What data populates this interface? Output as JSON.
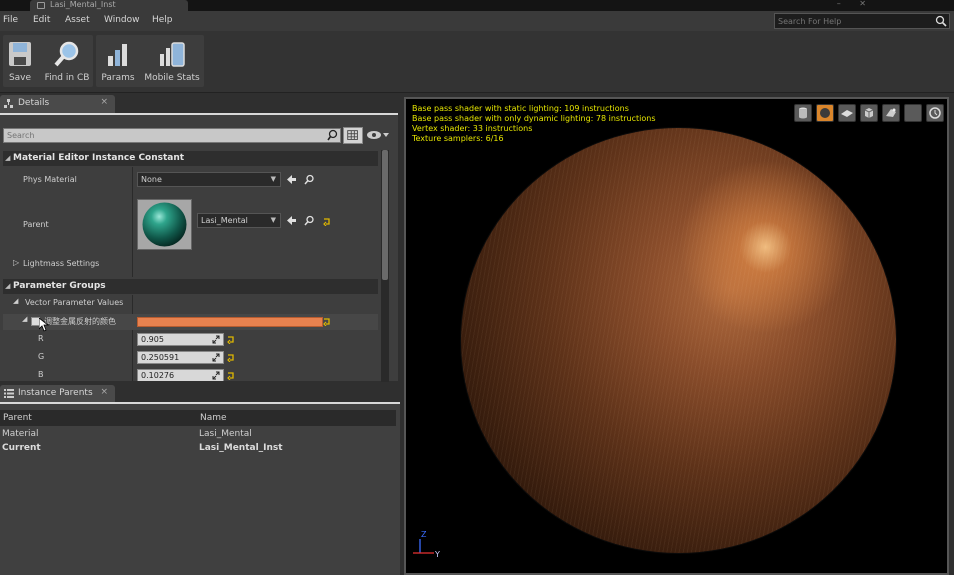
{
  "window": {
    "doc_tab_title": "Lasi_Mental_Inst",
    "window_glyphs": "–  ✕"
  },
  "menu": {
    "items": [
      "File",
      "Edit",
      "Asset",
      "Window",
      "Help"
    ],
    "help_search_placeholder": "Search For Help"
  },
  "toolbar": {
    "buttons": [
      {
        "label": "Save",
        "icon": "save-icon"
      },
      {
        "label": "Find in CB",
        "icon": "magnifier-icon"
      },
      {
        "label": "Params",
        "icon": "bars-icon"
      },
      {
        "label": "Mobile Stats",
        "icon": "mobile-stats-icon"
      }
    ]
  },
  "details": {
    "tab_label": "Details",
    "search_placeholder": "Search",
    "sections": {
      "constant": "Material Editor Instance Constant",
      "groups": "Parameter Groups"
    },
    "props": {
      "phys_material_label": "Phys Material",
      "phys_material_value": "None",
      "parent_label": "Parent",
      "parent_value": "Lasi_Mental",
      "lightmass_label": "Lightmass Settings",
      "vector_param_label": "Vector Parameter Values",
      "color_param_label": "调整金属反射的颜色",
      "color_swatch": "#e8824f",
      "r_label": "R",
      "r_value": "0.905",
      "g_label": "G",
      "g_value": "0.250591",
      "b_label": "B",
      "b_value": "0.10276"
    }
  },
  "instance_parents": {
    "tab_label": "Instance Parents",
    "columns": [
      "Parent",
      "Name"
    ],
    "rows": [
      {
        "parent": "Material",
        "name": "Lasi_Mental",
        "bold": false
      },
      {
        "parent": "Current",
        "name": "Lasi_Mental_Inst",
        "bold": true
      }
    ]
  },
  "viewport": {
    "stats": [
      "Base pass shader with static lighting: 109 instructions",
      "Base pass shader with only dynamic lighting: 78 instructions",
      "Vertex shader: 33 instructions",
      "Texture samplers: 6/16"
    ],
    "axis_z": "Z",
    "axis_y": "Y",
    "toolbar_icons": [
      "cylinder-icon",
      "sphere-icon",
      "plane-icon",
      "cube-icon",
      "mesh-icon",
      "blank-icon",
      "realtime-icon"
    ]
  },
  "colors": {
    "stats_text": "#e6e600",
    "accent_orange": "#d9852b"
  }
}
